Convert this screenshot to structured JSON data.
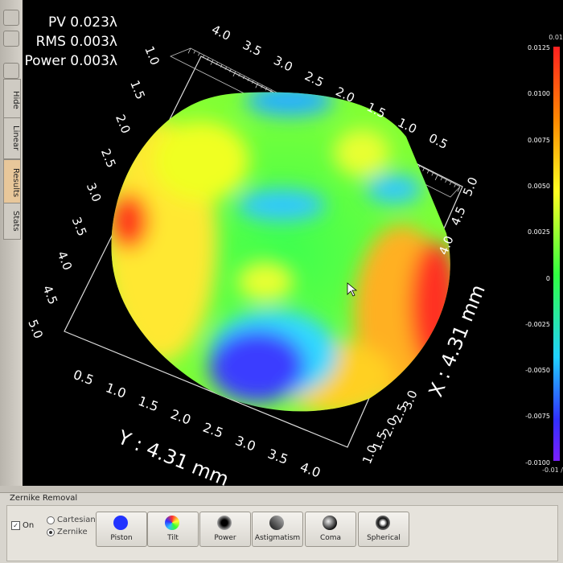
{
  "stats": {
    "pv": "PV 0.023λ",
    "rms": "RMS 0.003λ",
    "power": "Power 0.003λ"
  },
  "toolbar": {
    "tabs": [
      "Hide",
      "Linear",
      "Results",
      "Stats"
    ]
  },
  "axes": {
    "y_title": "Y : 4.31 mm",
    "x_title": "X : 4.31 mm",
    "top_ticks": [
      "4.0",
      "3.5",
      "3.0",
      "2.5",
      "2.0",
      "1.5",
      "1.0",
      "0.5"
    ],
    "left_ticks": [
      "1.0",
      "1.5",
      "2.0",
      "2.5",
      "3.0",
      "3.5",
      "4.0",
      "4.5",
      "5.0"
    ],
    "bottom_ticks": [
      "0.5",
      "1.0",
      "1.5",
      "2.0",
      "2.5",
      "3.0",
      "3.5",
      "4.0"
    ],
    "right_ticks": [
      "5.0",
      "4.5",
      "4.0"
    ],
    "right_lower_ticks": [
      "3.0",
      "2.5",
      "2.0",
      "1.5",
      "1.0"
    ]
  },
  "colorbar": {
    "ticks": [
      "0.0125",
      "0.0100",
      "0.0075",
      "0.0050",
      "0.0025",
      "0",
      "-0.0025",
      "-0.0050",
      "-0.0075",
      "-0.0100"
    ],
    "top_label": "0.01",
    "bottom_label": "-0.01 /"
  },
  "zernike": {
    "title": "Zernike Removal",
    "on_label": "On",
    "options": [
      "Cartesian",
      "Zernike"
    ],
    "selected_option": "Zernike",
    "buttons": [
      {
        "label": "Piston",
        "icon": "piston-icon"
      },
      {
        "label": "Tilt",
        "icon": "tilt-icon"
      },
      {
        "label": "Power",
        "icon": "power-icon"
      },
      {
        "label": "Astigmatism",
        "icon": "astigmatism-icon"
      },
      {
        "label": "Coma",
        "icon": "coma-icon"
      },
      {
        "label": "Spherical",
        "icon": "spherical-icon"
      }
    ]
  }
}
